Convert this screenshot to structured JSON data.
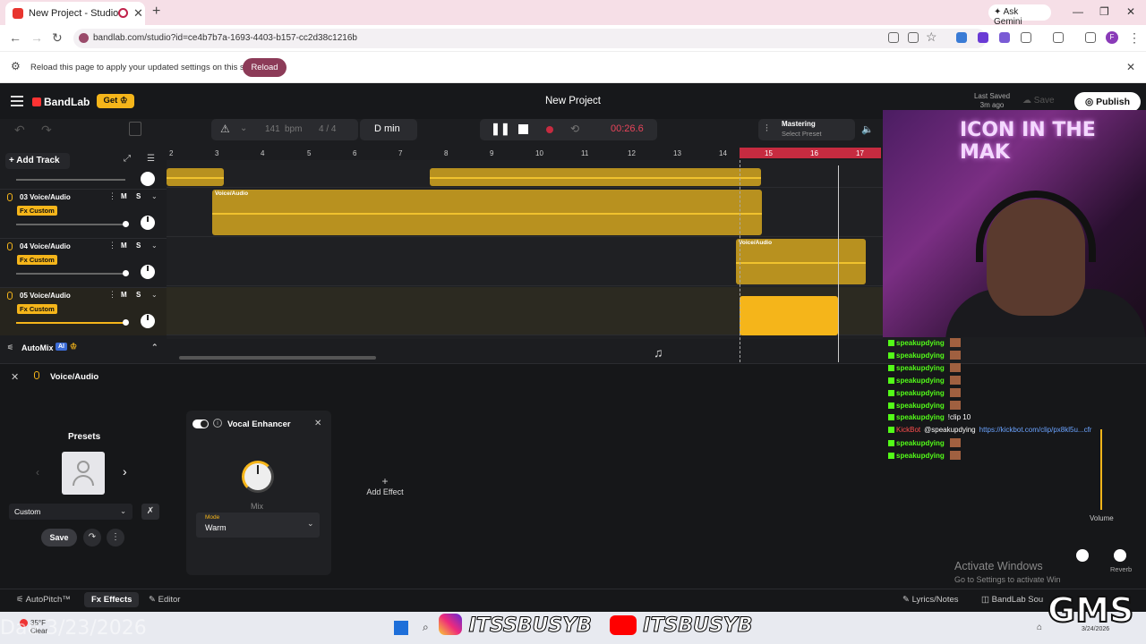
{
  "browser": {
    "tab_title": "New Project - Studio",
    "new_tab": "+",
    "gemini": "Ask Gemini",
    "url": "bandlab.com/studio?id=ce4b7b7a-1693-4403-b157-cc2d38c1216b",
    "infobar_message": "Reload this page to apply your updated settings on this site",
    "reload_label": "Reload",
    "profile_initial": "F"
  },
  "app": {
    "logo": "BandLab",
    "get_label": "Get",
    "project_title": "New Project",
    "last_saved_label": "Last Saved",
    "last_saved_time": "3m ago",
    "save_label": "Save",
    "publish_label": "Publish"
  },
  "toolbar": {
    "bpm_value": "141",
    "bpm_unit": "bpm",
    "time_signature": "4 / 4",
    "key": "D min",
    "time": "00:26.6",
    "mastering_label": "Mastering",
    "mastering_sub": "Select Preset"
  },
  "ruler": {
    "ticks": [
      "2",
      "3",
      "4",
      "5",
      "6",
      "7",
      "8",
      "9",
      "10",
      "11",
      "12",
      "13",
      "14",
      "15",
      "16",
      "17"
    ]
  },
  "tracklist": {
    "add_track": "Add Track",
    "tracks": [
      {
        "name": "03 Voice/Audio",
        "fx": "Fx Custom",
        "m": "M",
        "s": "S"
      },
      {
        "name": "04 Voice/Audio",
        "fx": "Fx Custom",
        "m": "M",
        "s": "S"
      },
      {
        "name": "05 Voice/Audio",
        "fx": "Fx Custom",
        "m": "M",
        "s": "S"
      }
    ],
    "automix": "AutoMix",
    "ai_badge": "AI"
  },
  "clips": {
    "label": "Voice/Audio"
  },
  "panel": {
    "track_name": "Voice/Audio",
    "presets_title": "Presets",
    "preset_value": "Custom",
    "save_label": "Save",
    "effect_name": "Vocal Enhancer",
    "knob_label": "Mix",
    "mode_label": "Mode",
    "mode_value": "Warm",
    "add_effect": "Add Effect"
  },
  "bottombar": {
    "autopitch": "AutoPitch™",
    "effects": "Effects",
    "editor": "Editor",
    "lyrics": "Lyrics/Notes",
    "sounds": "BandLab Sou"
  },
  "overlay": {
    "webcam_sign": "ICON IN THE MAK",
    "chat": [
      {
        "user": "speakupdying",
        "text": ""
      },
      {
        "user": "speakupdying",
        "text": ""
      },
      {
        "user": "speakupdying",
        "text": ""
      },
      {
        "user": "speakupdying",
        "text": ""
      },
      {
        "user": "speakupdying",
        "text": ""
      },
      {
        "user": "speakupdying",
        "text": ""
      },
      {
        "user": "speakupdying",
        "text": "!clip 10"
      },
      {
        "user": "KickBot",
        "text": "@speakupdying",
        "link": "https://kickbot.com/clip/px8kl5u...cfr"
      },
      {
        "user": "speakupdying",
        "text": ""
      },
      {
        "user": "speakupdying",
        "text": ""
      }
    ],
    "volume_label": "Volume",
    "reverb_label": "Reverb",
    "activate_title": "Activate Windows",
    "activate_sub": "Go to Settings to activate Win",
    "gms": "GMS",
    "social_handle": "ITSSBUSYB",
    "social_handle2": "ITSBUSYB",
    "date_watermark": "Dae 3/23/2026"
  },
  "taskbar": {
    "temp": "35°F",
    "weather": "Clear",
    "date": "3/24/2026"
  },
  "colors": {
    "accent": "#f5b51a",
    "clip": "#b8911f",
    "record": "#c62b40",
    "kick_green": "#53fc18"
  }
}
